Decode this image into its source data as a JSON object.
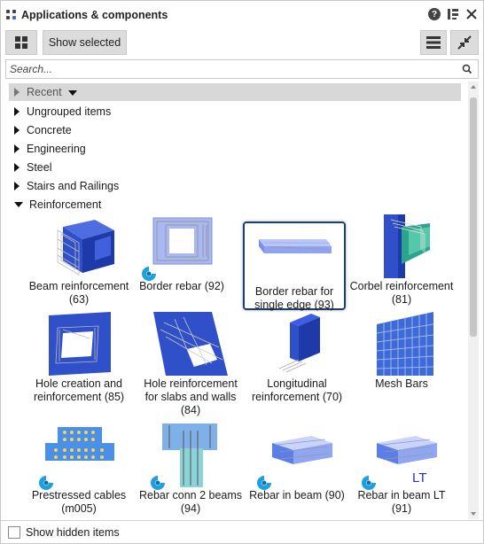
{
  "window": {
    "title": "Applications & components"
  },
  "toolbar": {
    "show_selected": "Show selected"
  },
  "search": {
    "placeholder": "Search..."
  },
  "tree": {
    "recent": "Recent",
    "items": [
      "Ungrouped items",
      "Concrete",
      "Engineering",
      "Steel",
      "Stairs and Railings",
      "Reinforcement"
    ]
  },
  "components": [
    {
      "l1": "Beam reinforcement",
      "l2": "(63)"
    },
    {
      "l1": "Border rebar (92)",
      "l2": ""
    },
    {
      "l1": "Border rebar for",
      "l2": "single edge (93)"
    },
    {
      "l1": "Corbel reinforcement",
      "l2": "(81)"
    },
    {
      "l1": "Hole creation and",
      "l2": "reinforcement (85)"
    },
    {
      "l1": "Hole reinforcement",
      "l2": "for slabs and walls",
      "l3": "(84)"
    },
    {
      "l1": "Longitudinal",
      "l2": "reinforcement (70)"
    },
    {
      "l1": "Mesh Bars",
      "l2": ""
    },
    {
      "l1": "Prestressed cables",
      "l2": "(m005)"
    },
    {
      "l1": "Rebar conn 2 beams",
      "l2": "(94)"
    },
    {
      "l1": "Rebar in beam (90)",
      "l2": ""
    },
    {
      "l1": "Rebar in beam LT (91)",
      "l2": ""
    }
  ],
  "lt_label": "LT",
  "footer": {
    "show_hidden": "Show hidden items"
  },
  "colors": {
    "accent": "#1b3f6b",
    "steel_blue": "#2a4fbf",
    "badge_blue": "#1ea0e0"
  }
}
